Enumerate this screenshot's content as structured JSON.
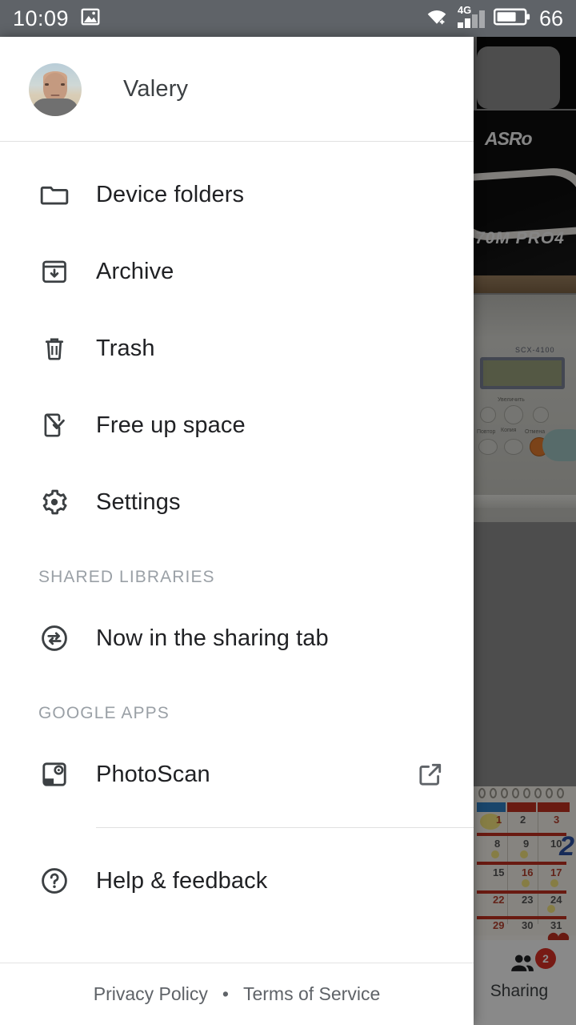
{
  "status_bar": {
    "time": "10:09",
    "photos_icon": "image-icon",
    "wifi_icon": "wifi-icon",
    "network_type": "4G",
    "signal_icon": "signal-bars-icon",
    "battery_icon": "battery-icon",
    "battery_level": "66",
    "background_color": "#5f6368"
  },
  "drawer": {
    "account": {
      "avatar": "user-avatar",
      "name": "Valery",
      "email": ""
    },
    "primary_items": [
      {
        "icon": "folder-icon",
        "label": "Device folders"
      },
      {
        "icon": "archive-icon",
        "label": "Archive"
      },
      {
        "icon": "trash-icon",
        "label": "Trash"
      },
      {
        "icon": "free-space-icon",
        "label": "Free up space"
      },
      {
        "icon": "gear-icon",
        "label": "Settings"
      }
    ],
    "shared_libraries": {
      "header": "SHARED LIBRARIES",
      "items": [
        {
          "icon": "sharing-swap-icon",
          "label": "Now in the sharing tab"
        }
      ]
    },
    "google_apps": {
      "header": "GOOGLE APPS",
      "items": [
        {
          "icon": "photoscan-icon",
          "label": "PhotoScan",
          "trailing_icon": "open-external-icon"
        }
      ]
    },
    "help": {
      "icon": "help-circle-icon",
      "label": "Help & feedback"
    },
    "footer": {
      "privacy_label": "Privacy Policy",
      "separator": "•",
      "terms_label": "Terms of Service"
    }
  },
  "background": {
    "bottom_nav": {
      "tab": {
        "icon": "people-icon",
        "label": "Sharing",
        "badge": "2",
        "badge_color": "#d93025"
      }
    },
    "photos": [
      {
        "name": "motherboard-box-photo",
        "brand_text": "ASRo",
        "model_text": "70M PRO4"
      },
      {
        "name": "printer-fax-photo",
        "screen_text": "SCX-4100"
      },
      {
        "name": "wall-calendar-photo"
      }
    ]
  }
}
